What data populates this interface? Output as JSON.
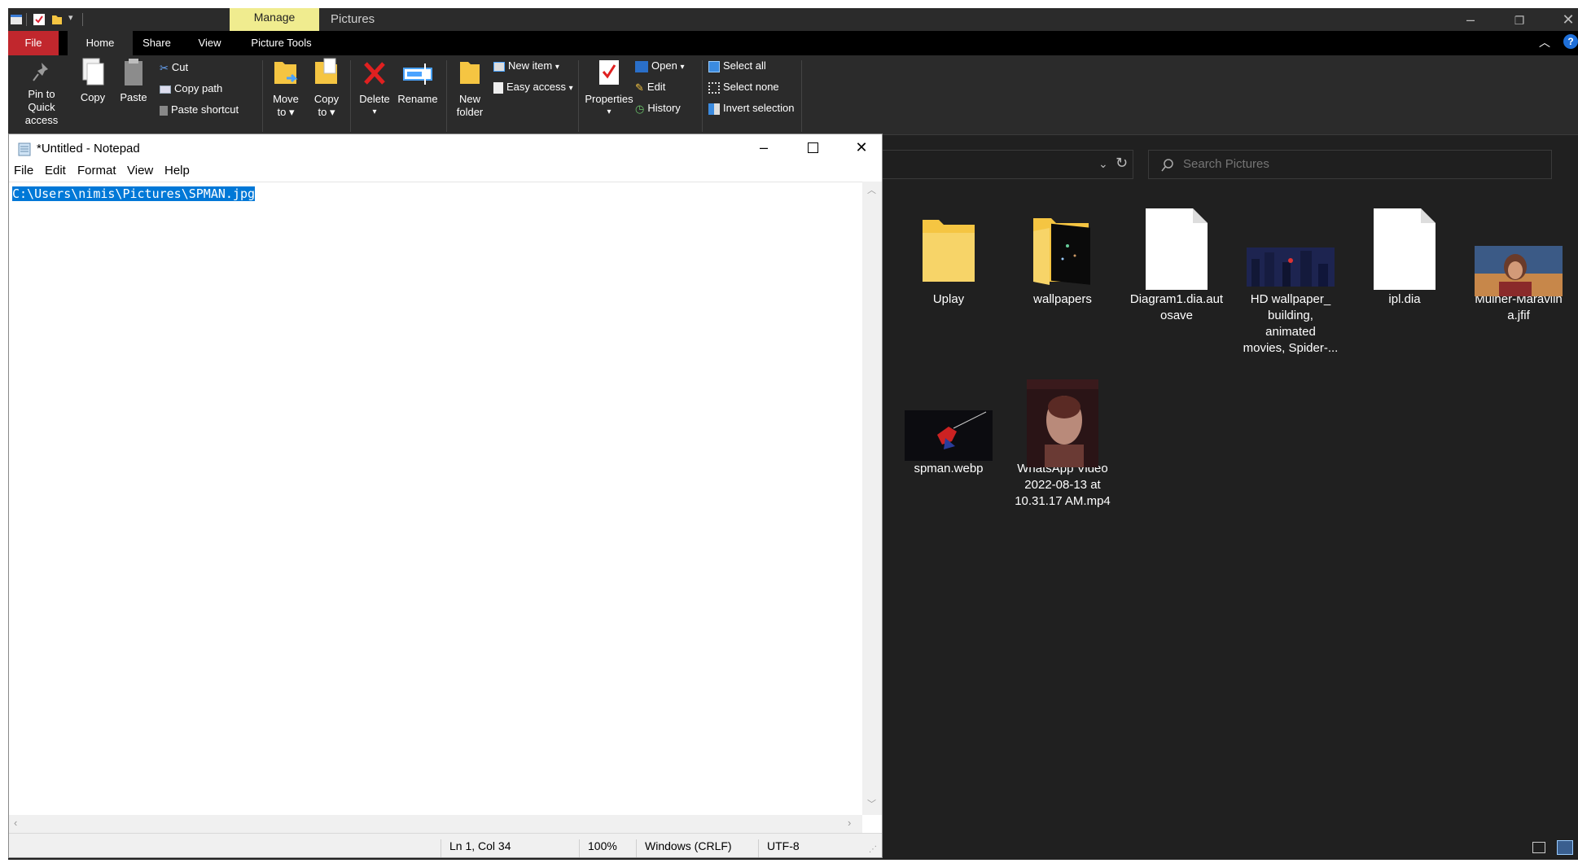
{
  "explorer": {
    "title": "Pictures",
    "contextual_tab": "Manage",
    "tabs": [
      "File",
      "Home",
      "Share",
      "View",
      "Picture Tools"
    ],
    "ribbon": {
      "pin_label_1": "Pin to Quick",
      "pin_label_2": "access",
      "copy": "Copy",
      "paste": "Paste",
      "cut": "Cut",
      "copy_path": "Copy path",
      "paste_shortcut": "Paste shortcut",
      "move_to_1": "Move",
      "move_to_2": "to",
      "copy_to_1": "Copy",
      "copy_to_2": "to",
      "delete": "Delete",
      "rename": "Rename",
      "new_folder_1": "New",
      "new_folder_2": "folder",
      "new_item": "New item",
      "easy_access": "Easy access",
      "properties": "Properties",
      "open": "Open",
      "edit": "Edit",
      "history": "History",
      "select_all": "Select all",
      "select_none": "Select none",
      "invert_selection": "Invert selection"
    },
    "search_placeholder": "Search Pictures",
    "files_row1": [
      {
        "label_lines": [
          "Uplay"
        ],
        "icon": "folder-icon"
      },
      {
        "label_lines": [
          "wallpapers"
        ],
        "icon": "folder-icon"
      },
      {
        "label_lines": [
          "Diagram1.dia.aut",
          "osave"
        ],
        "icon": "document-icon"
      },
      {
        "label_lines": [
          "HD wallpaper_",
          "building,",
          "animated",
          "movies, Spider-..."
        ],
        "icon": "image-thumbnail"
      },
      {
        "label_lines": [
          "ipl.dia"
        ],
        "icon": "document-icon"
      },
      {
        "label_lines": [
          "Mulher-Maravilh",
          "a.jfif"
        ],
        "icon": "image-thumbnail"
      }
    ],
    "files_row2": [
      {
        "label_lines": [
          "spman.webp"
        ],
        "icon": "image-thumbnail"
      },
      {
        "label_lines": [
          "WhatsApp Video",
          "2022-08-13 at",
          "10.31.17 AM.mp4"
        ],
        "icon": "video-thumbnail"
      }
    ]
  },
  "notepad": {
    "title": "*Untitled - Notepad",
    "menus": [
      "File",
      "Edit",
      "Format",
      "View",
      "Help"
    ],
    "content": "C:\\Users\\nimis\\Pictures\\SPMAN.jpg",
    "status": {
      "position": "Ln 1, Col 34",
      "zoom": "100%",
      "line_ending": "Windows (CRLF)",
      "encoding": "UTF-8"
    }
  },
  "colors": {
    "file_tab": "#c1272d",
    "manage_tab": "#f0ec8f",
    "selection": "#0078d7",
    "dark_bg": "#202020"
  }
}
